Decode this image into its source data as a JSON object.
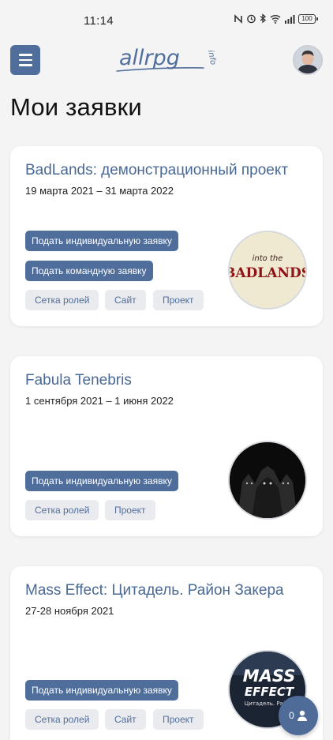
{
  "status": {
    "time": "11:14",
    "battery": "100"
  },
  "header": {
    "logo_text": "allrpg",
    "logo_suffix": "info"
  },
  "page": {
    "title": "Мои заявки"
  },
  "cards": [
    {
      "title": "BadLands: демонстрационный проект",
      "dates": "19 марта 2021 – 31 марта 2022",
      "primary_buttons": [
        "Подать индивидуальную заявку",
        "Подать командную заявку"
      ],
      "secondary_buttons": [
        "Сетка ролей",
        "Сайт",
        "Проект"
      ],
      "image_icon": "badlands-logo",
      "image_text_small": "into the",
      "image_text_big": "BADLANDS"
    },
    {
      "title": "Fabula Tenebris",
      "dates": "1 сентября 2021 – 1 июня 2022",
      "primary_buttons": [
        "Подать индивидуальную заявку"
      ],
      "secondary_buttons": [
        "Сетка ролей",
        "Проект"
      ],
      "image_icon": "dark-figures-image"
    },
    {
      "title": "Mass Effect: Цитадель. Район Закера",
      "dates": "27-28 ноября 2021",
      "primary_buttons": [
        "Подать индивидуальную заявку"
      ],
      "secondary_buttons": [
        "Сетка ролей",
        "Сайт",
        "Проект"
      ],
      "image_icon": "mass-effect-logo",
      "image_text_big": "MASS",
      "image_text_mid": "EFFECT",
      "image_text_small": "Цитадель. Район"
    }
  ],
  "fab": {
    "count": "0",
    "icon": "user-icon"
  },
  "colors": {
    "primary": "#506e9c",
    "title": "#4a6994",
    "ghost_bg": "#e9ebef"
  }
}
